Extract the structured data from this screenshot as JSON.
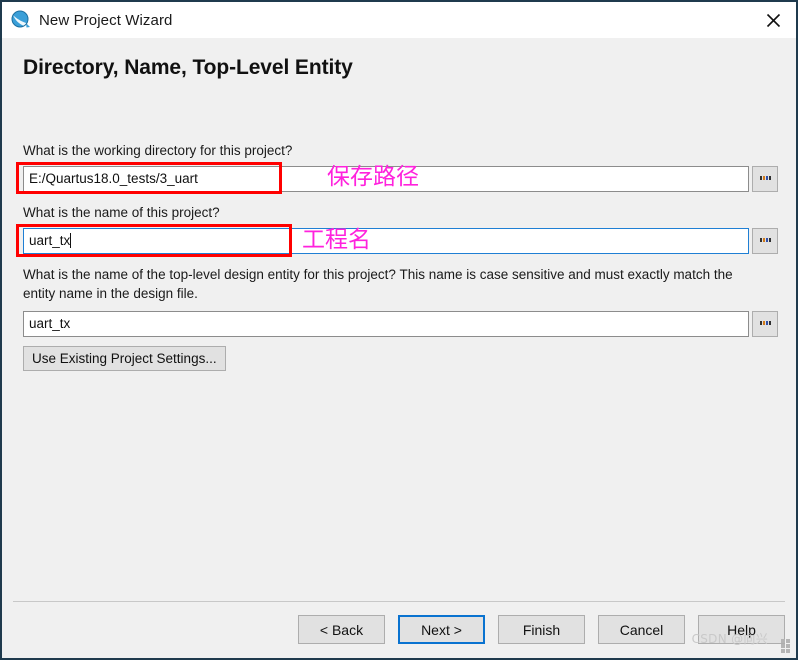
{
  "window": {
    "title": "New Project Wizard",
    "app_icon": "quartus-globe-icon",
    "close_label": "✕"
  },
  "page": {
    "heading": "Directory, Name, Top-Level Entity"
  },
  "fields": {
    "working_directory": {
      "question": "What is the working directory for this project?",
      "value": "E:/Quartus18.0_tests/3_uart",
      "browse_label": "...",
      "focused": false
    },
    "project_name": {
      "question": "What is the name of this project?",
      "value": "uart_tx",
      "browse_label": "...",
      "focused": true
    },
    "top_level_entity": {
      "question": "What is the name of the top-level design entity for this project? This name is case sensitive and must exactly match the entity name in the design file.",
      "value": "uart_tx",
      "browse_label": "...",
      "focused": false
    }
  },
  "actions": {
    "use_existing": "Use Existing Project Settings..."
  },
  "annotations": {
    "path_label": "保存路径",
    "name_label": "工程名",
    "box_color": "#ff0000",
    "text_color": "#ff22dd"
  },
  "footer": {
    "buttons": [
      {
        "label": "< Back",
        "default": false
      },
      {
        "label": "Next >",
        "default": true
      },
      {
        "label": "Finish",
        "default": false
      },
      {
        "label": "Cancel",
        "default": false
      },
      {
        "label": "Help",
        "default": false
      }
    ],
    "watermark": "CSDN @向兴"
  }
}
